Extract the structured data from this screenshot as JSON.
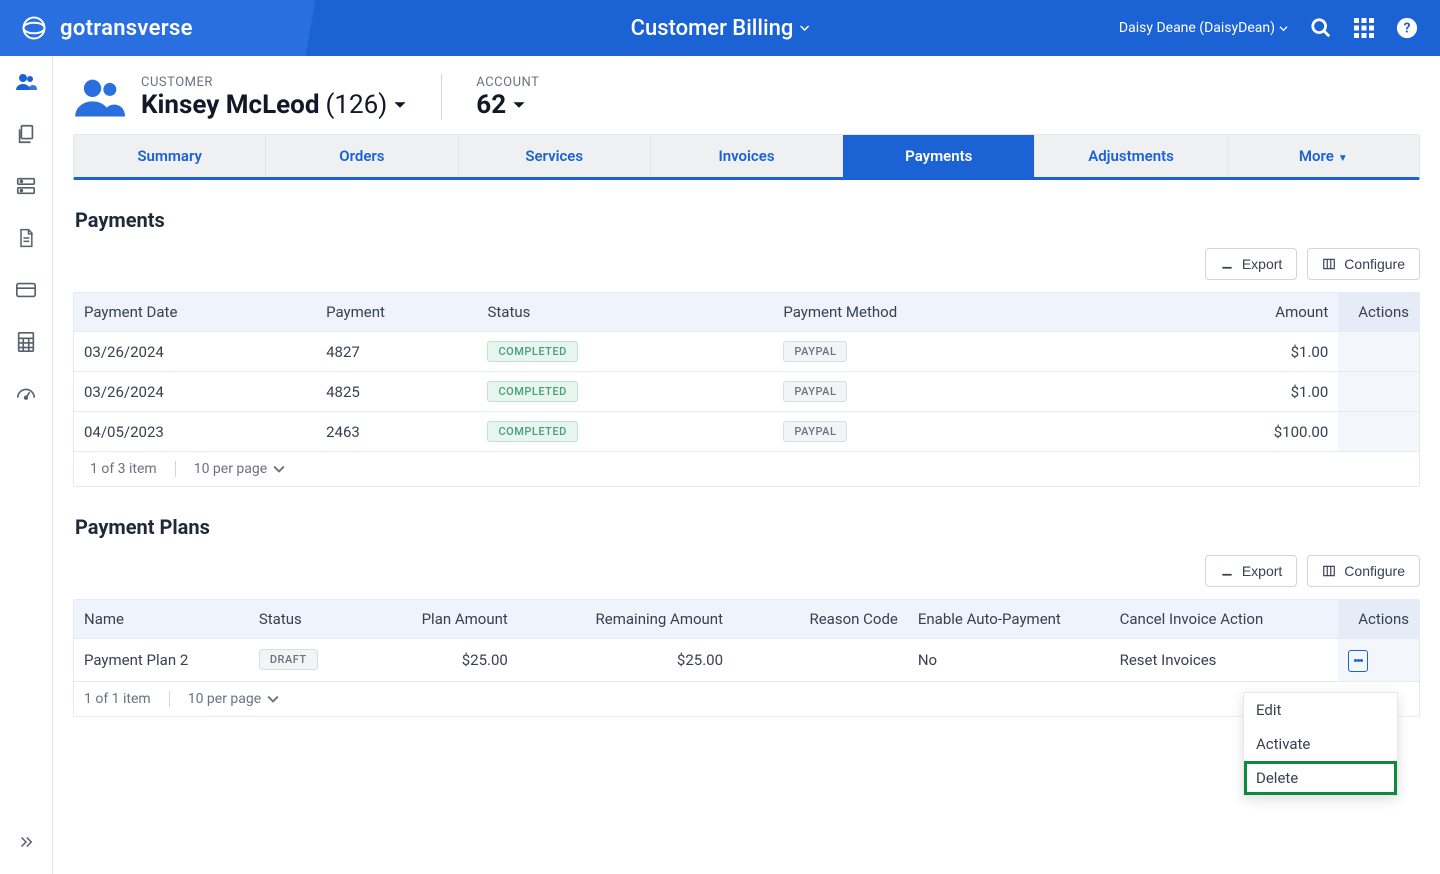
{
  "app": {
    "name": "gotransverse",
    "section": "Customer Billing"
  },
  "user": {
    "display": "Daisy Deane (DaisyDean)"
  },
  "breadcrumb": {
    "customer_label": "CUSTOMER",
    "customer_name": "Kinsey McLeod",
    "customer_count": "(126)",
    "account_label": "ACCOUNT",
    "account_number": "62"
  },
  "tabs": {
    "summary": "Summary",
    "orders": "Orders",
    "services": "Services",
    "invoices": "Invoices",
    "payments": "Payments",
    "adjustments": "Adjustments",
    "more": "More"
  },
  "buttons": {
    "export": "Export",
    "configure": "Configure"
  },
  "payments": {
    "title": "Payments",
    "columns": {
      "date": "Payment Date",
      "payment": "Payment",
      "status": "Status",
      "method": "Payment Method",
      "amount": "Amount",
      "actions": "Actions"
    },
    "rows": [
      {
        "date": "03/26/2024",
        "payment": "4827",
        "status": "COMPLETED",
        "method": "PAYPAL",
        "amount": "$1.00"
      },
      {
        "date": "03/26/2024",
        "payment": "4825",
        "status": "COMPLETED",
        "method": "PAYPAL",
        "amount": "$1.00"
      },
      {
        "date": "04/05/2023",
        "payment": "2463",
        "status": "COMPLETED",
        "method": "PAYPAL",
        "amount": "$100.00"
      }
    ],
    "pager": {
      "count": "1 of 3 item",
      "perpage": "10 per page"
    }
  },
  "plans": {
    "title": "Payment Plans",
    "columns": {
      "name": "Name",
      "status": "Status",
      "plan_amount": "Plan Amount",
      "remaining": "Remaining Amount",
      "reason": "Reason Code",
      "autopay": "Enable Auto-Payment",
      "cancel_action": "Cancel Invoice Action",
      "actions": "Actions"
    },
    "rows": [
      {
        "name": "Payment Plan 2",
        "status": "DRAFT",
        "plan_amount": "$25.00",
        "remaining": "$25.00",
        "reason": "",
        "autopay": "No",
        "cancel_action": "Reset Invoices"
      }
    ],
    "pager": {
      "count": "1 of 1 item",
      "perpage": "10 per page"
    }
  },
  "menu": {
    "edit": "Edit",
    "activate": "Activate",
    "delete": "Delete"
  }
}
